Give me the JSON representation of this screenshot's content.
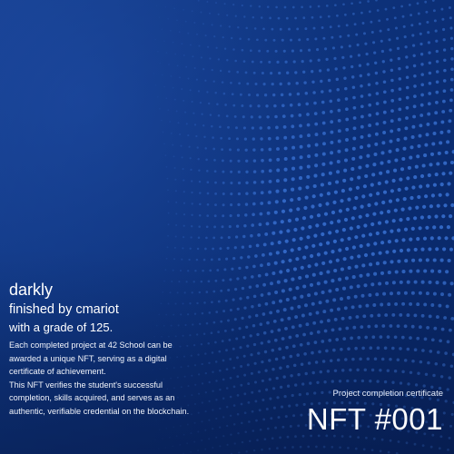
{
  "card": {
    "project": "darkly",
    "finished_by": "finished by cmariot",
    "grade": "with a grade of 125.",
    "description": "Each completed project at 42 School can be awarded a unique NFT, serving as a digital certificate of achievement.\nThis NFT verifies the student's successful completion, skills acquired, and serves as an authentic, verifiable credential on the blockchain.",
    "certificate_label": "Project completion certificate",
    "nft_id": "NFT #001"
  },
  "colors": {
    "background_dark": "#082562",
    "background_light": "#163f8e",
    "dot_color": "#3f7be0",
    "text": "#ffffff"
  }
}
